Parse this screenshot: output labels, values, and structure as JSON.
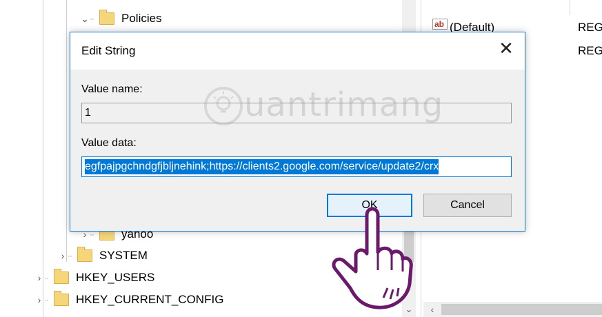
{
  "tree": {
    "items": [
      {
        "label": "Policies",
        "expanded": true
      },
      {
        "label": "yahoo",
        "expanded": false
      },
      {
        "label": "SYSTEM",
        "expanded": false
      },
      {
        "label": "HKEY_USERS",
        "expanded": false
      },
      {
        "label": "HKEY_CURRENT_CONFIG",
        "expanded": false
      }
    ]
  },
  "values_pane": {
    "rows": [
      {
        "name": "(Default)",
        "type": "REG"
      },
      {
        "name": "",
        "type": "REG"
      }
    ]
  },
  "dialog": {
    "title": "Edit String",
    "value_name_label": "Value name:",
    "value_name": "1",
    "value_data_label": "Value data:",
    "value_data": "egfpajpgchndgfjbljnehink;https://clients2.google.com/service/update2/crx",
    "ok_label": "OK",
    "cancel_label": "Cancel"
  },
  "watermark": {
    "text": "uantrimang"
  }
}
